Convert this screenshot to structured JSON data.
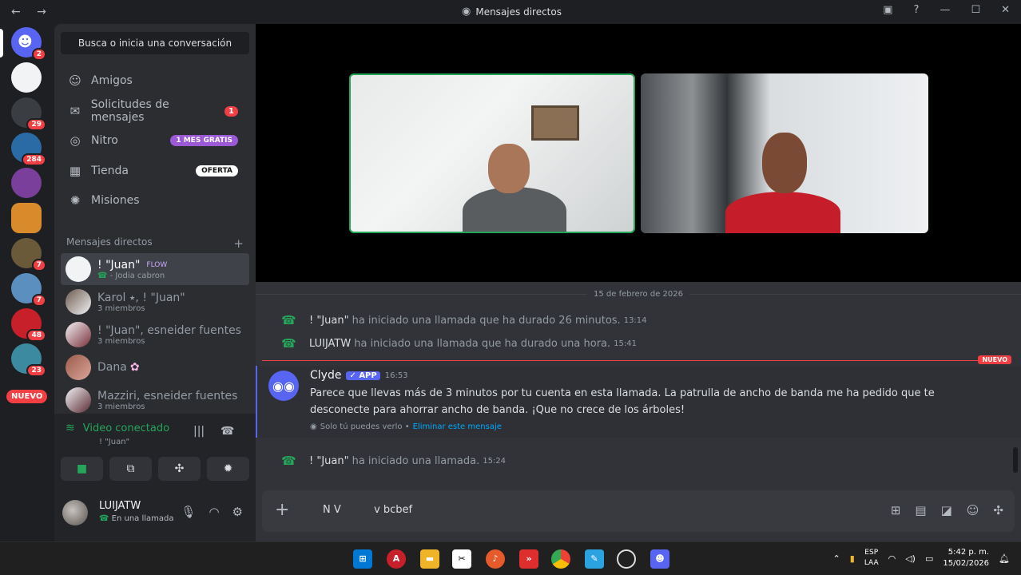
{
  "window": {
    "title": "Mensajes directos",
    "nav_arrows": "← →"
  },
  "guilds": [
    {
      "badge": "2",
      "color": "#5865f2"
    },
    {
      "badge": "",
      "color": "#f2f3f5"
    },
    {
      "badge": "29",
      "color": "#3a3d42"
    },
    {
      "badge": "284",
      "color": "#2a6aa5"
    },
    {
      "badge": "",
      "color": "#7a3f9b"
    },
    {
      "badge": "",
      "color": "#d98a2b"
    },
    {
      "badge": "7",
      "color": "#6b5a3a"
    },
    {
      "badge": "7",
      "color": "#5b8fbf"
    },
    {
      "badge": "48",
      "color": "#c8202a"
    },
    {
      "badge": "23",
      "color": "#3b8aa0"
    }
  ],
  "guild_new_label": "NUEVO",
  "sidebar": {
    "search_placeholder": "Busca o inicia una conversación",
    "nav": [
      {
        "label": "Amigos",
        "icon": "person-wave-icon"
      },
      {
        "label": "Solicitudes de mensajes",
        "icon": "envelope-icon",
        "count": "1"
      },
      {
        "label": "Nitro",
        "icon": "nitro-icon",
        "tag": "1 MES GRATIS"
      },
      {
        "label": "Tienda",
        "icon": "shop-icon",
        "tag": "OFERTA"
      },
      {
        "label": "Misiones",
        "icon": "compass-icon"
      }
    ],
    "dm_header": "Mensajes directos",
    "dms": [
      {
        "name": "! \"Juan\"",
        "tag": "FLOW",
        "sub": "- Jodia cabron"
      },
      {
        "name": "Karol ⭑, ! \"Juan\"",
        "sub": "3 miembros"
      },
      {
        "name": "! \"Juan\", esneider fuentes",
        "sub": "3 miembros"
      },
      {
        "name": "Dana",
        "sub": ""
      },
      {
        "name": "Mazziri, esneider fuentes",
        "sub": "3 miembros"
      }
    ]
  },
  "voice": {
    "status": "Video conectado",
    "channel": "! \"Juan\""
  },
  "user": {
    "name": "LUIJATW",
    "status": "En una llamada"
  },
  "chat": {
    "date": "15 de febrero de 2026",
    "messages": [
      {
        "who": "! \"Juan\"",
        "text": "ha iniciado una llamada que ha durado 26 minutos.",
        "time": "13:14"
      },
      {
        "who": "LUIJATW",
        "text": "ha iniciado una llamada que ha durado una hora.",
        "time": "15:41"
      }
    ],
    "new_label": "NUEVO",
    "clyde": {
      "name": "Clyde",
      "badge": "✓ APP",
      "time": "16:53",
      "text": "Parece que llevas más de 3 minutos por tu cuenta en esta llamada. La patrulla de ancho de banda me ha pedido que te desconecte para ahorrar ancho de banda. ¡Que no crece de los árboles!",
      "note": "Solo tú puedes verlo •",
      "note_link": "Eliminar este mensaje"
    },
    "last": {
      "who": "! \"Juan\"",
      "text": "ha iniciado una llamada.",
      "time": "15:24"
    }
  },
  "composer": {
    "draft": "N V          v bcbef"
  },
  "taskbar": {
    "lang_top": "ESP",
    "lang_bottom": "LAA",
    "time": "5:42 p. m.",
    "date": "15/02/2026"
  },
  "colors": {
    "accent": "#5865f2",
    "online": "#23a55a",
    "danger": "#f23f43"
  }
}
